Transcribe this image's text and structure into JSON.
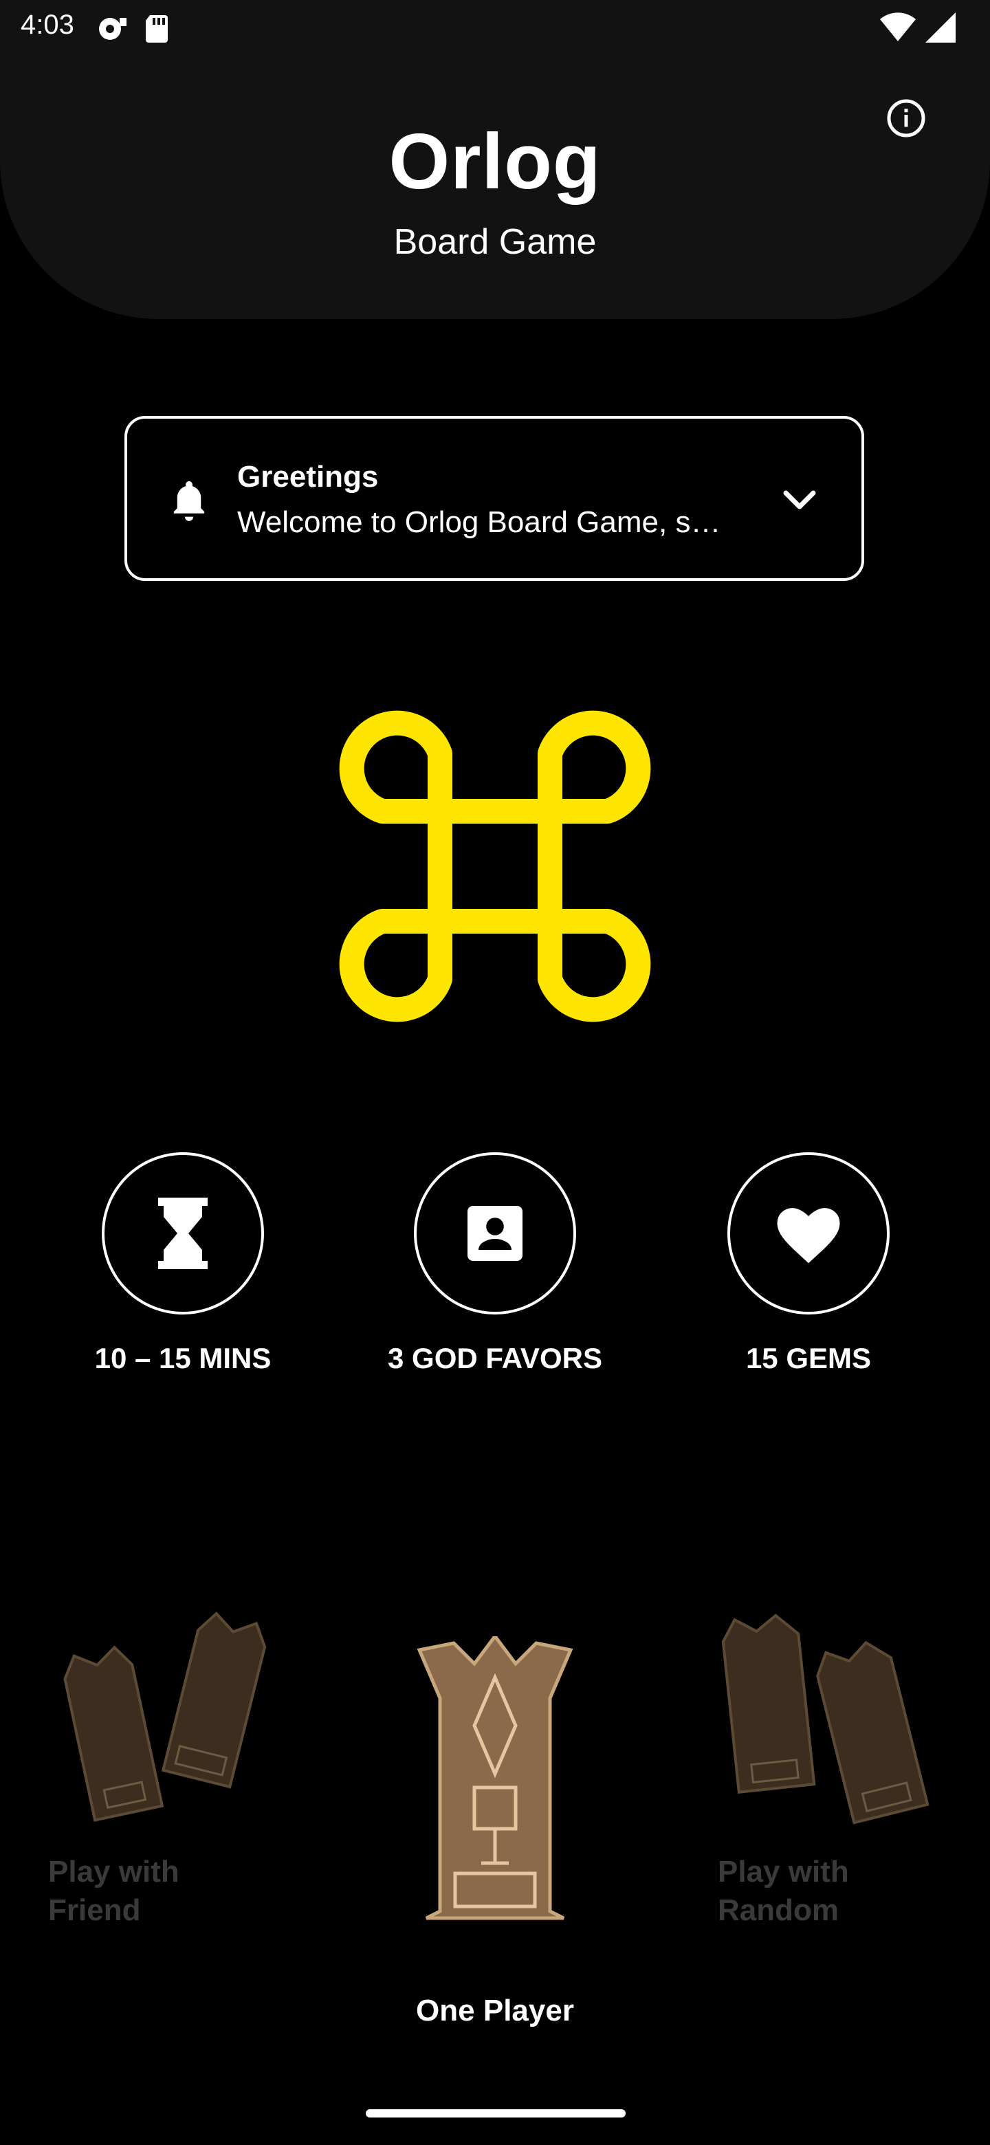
{
  "status_bar": {
    "time": "4:03"
  },
  "header": {
    "title": "Orlog",
    "subtitle": "Board Game"
  },
  "greeting_card": {
    "title": "Greetings",
    "message": "Welcome to Orlog Board Game, s…"
  },
  "features": [
    {
      "label": "10 – 15 MINS",
      "icon": "hourglass-icon"
    },
    {
      "label": "3 GOD FAVORS",
      "icon": "contact-card-icon"
    },
    {
      "label": "15 GEMS",
      "icon": "heart-icon"
    }
  ],
  "modes": {
    "friend_label": "Play with\nFriend",
    "one_player_label": "One Player",
    "random_label": "Play with\nRandom"
  },
  "colors": {
    "accent": "#FFE600",
    "header_bg": "#121212",
    "background": "#000000",
    "tile_bronze": "#8a6a4a"
  }
}
